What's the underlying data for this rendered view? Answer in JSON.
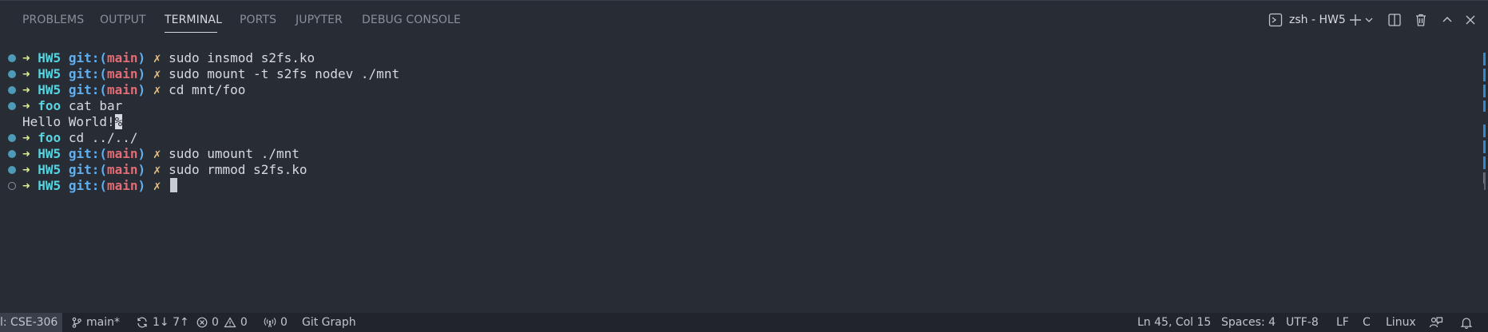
{
  "panel_tabs": [
    "PROBLEMS",
    "OUTPUT",
    "TERMINAL",
    "PORTS",
    "JUPYTER",
    "DEBUG CONSOLE"
  ],
  "active_tab": "TERMINAL",
  "terminal_selector": {
    "label": "zsh - HW5",
    "icon": "terminal-icon"
  },
  "panel_actions": [
    "new-terminal-plus-icon",
    "chevron-down-icon",
    "split-terminal-icon",
    "trash-icon",
    "maximize-panel-icon",
    "close-icon"
  ],
  "prompt": {
    "arrow": "➜",
    "dir": "HW5",
    "git_prefix": "git:(",
    "branch": "main",
    "git_suffix": ")",
    "dirty": "✗"
  },
  "terminal_lines": {
    "l1": {
      "cmd": "sudo insmod s2fs.ko"
    },
    "l2": {
      "cmd": "sudo mount -t s2fs nodev ./mnt"
    },
    "l3": {
      "cmd": "cd mnt/foo"
    },
    "l4": {
      "dir": "foo",
      "cmd": "cat bar"
    },
    "l5": {
      "output": "Hello World!",
      "eol_mark": "%"
    },
    "l6": {
      "dir": "foo",
      "cmd": "cd ../../"
    },
    "l7": {
      "cmd": "sudo umount ./mnt"
    },
    "l8": {
      "cmd": "sudo rmmod s2fs.ko"
    },
    "l9": {
      "cmd": ""
    }
  },
  "status_bar": {
    "remote": "l: CSE-306",
    "branch": "main*",
    "sync": "1↓ 7↑",
    "errors": "0",
    "warnings": "0",
    "ports": "0",
    "git_graph": "Git Graph",
    "position": "Ln 45, Col 15",
    "spaces": "Spaces: 4",
    "encoding": "UTF-8",
    "eol": "LF",
    "language": "C",
    "platform": "Linux"
  },
  "colors": {
    "background": "#282c34",
    "status_bar": "#21252b",
    "prompt_arrow": "#d4f095",
    "dir": "#56d4e0",
    "git": "#61afef",
    "branch": "#e06c75",
    "dirty": "#e5c07b",
    "accent": "#2f8bcb"
  }
}
